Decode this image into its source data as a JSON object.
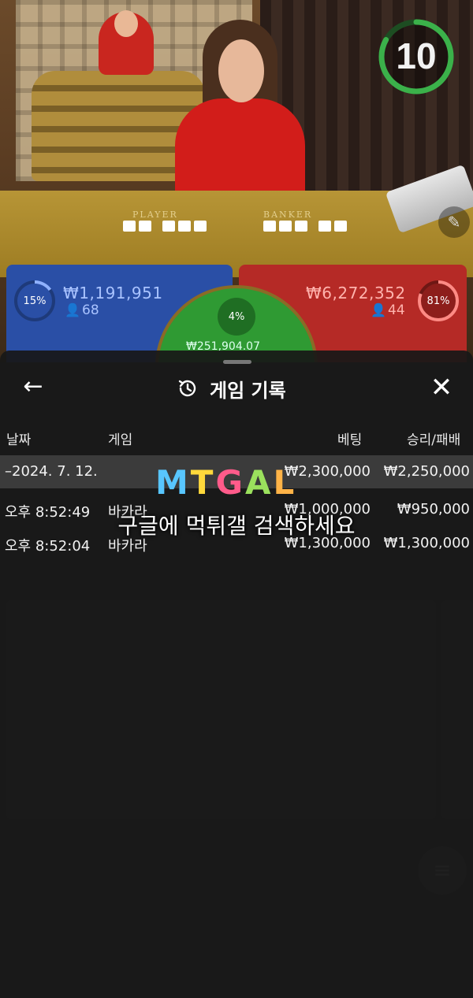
{
  "timer": {
    "seconds": "10",
    "progress_fraction": 0.83,
    "color": "#3bb14a"
  },
  "table_labels": {
    "player": "PLAYER",
    "banker": "BANKER"
  },
  "bets": {
    "player": {
      "percent": "15%",
      "amount": "₩1,191,951",
      "players": "68",
      "color": "#2a4fa6"
    },
    "tie": {
      "percent": "4%",
      "amount": "₩251,904.07",
      "color": "#2f9a33"
    },
    "banker": {
      "percent": "81%",
      "amount": "₩6,272,352",
      "players": "44",
      "color": "#b52a26"
    }
  },
  "history": {
    "title": "게임 기록",
    "columns": {
      "date": "날짜",
      "game": "게임",
      "bet": "베팅",
      "result": "승리/패배"
    },
    "date_row": {
      "date": "–2024. 7. 12.",
      "bet_total": "₩2,300,000",
      "result_total": "₩2,250,000"
    },
    "rows": [
      {
        "time": "오후 8:52:49",
        "game": "바카라",
        "bet": "₩1,000,000",
        "result": "₩950,000"
      },
      {
        "time": "오후 8:52:04",
        "game": "바카라",
        "bet": "₩1,300,000",
        "result": "₩1,300,000"
      }
    ]
  },
  "watermark": {
    "logo": "MTGAL",
    "text": "구글에 먹튀갤 검색하세요"
  },
  "icons": {
    "back": "arrow-left-icon",
    "history": "history-clock-icon",
    "close": "close-icon",
    "edit": "pencil-icon",
    "user": "user-icon",
    "menu": "menu-icon"
  }
}
